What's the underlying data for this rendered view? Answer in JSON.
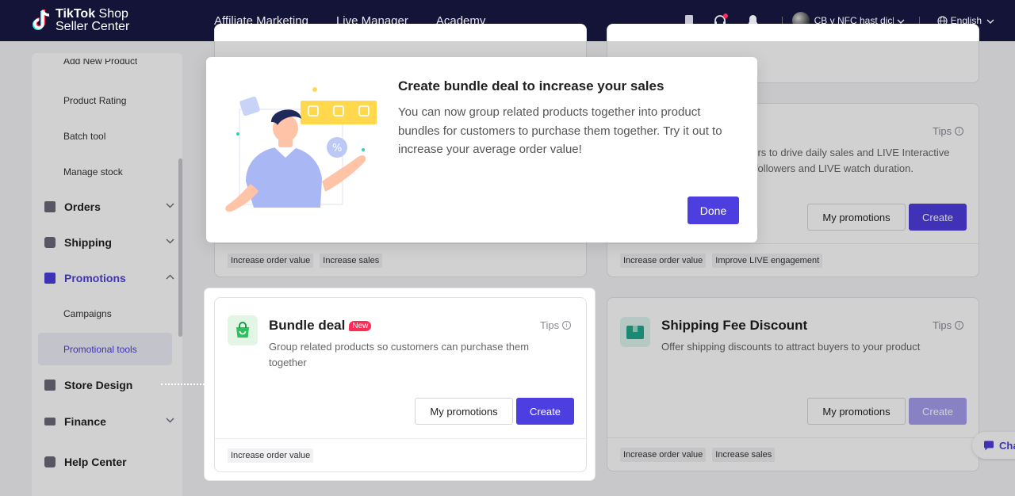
{
  "topbar": {
    "logo_line1_bold": "TikTok",
    "logo_line1_rest": " Shop",
    "logo_line2": "Seller Center",
    "nav": [
      "Affiliate Marketing",
      "Live Manager",
      "Academy"
    ],
    "account_name": "CB v NFC hast dich v",
    "language": "English"
  },
  "sidebar": {
    "sub_items_top": [
      "Add New Product",
      "Product Rating",
      "Batch tool",
      "Manage stock"
    ],
    "orders": "Orders",
    "shipping": "Shipping",
    "promotions": "Promotions",
    "promotions_sub": [
      "Campaigns",
      "Promotional tools"
    ],
    "store_design": "Store Design",
    "finance": "Finance",
    "help_center": "Help Center"
  },
  "cards": {
    "top_right": {
      "desc": "ners to drive daily sales and LIVE Interactive e followers and LIVE watch duration.",
      "desc_line1": "ners to drive daily sales and LIVE Interactive",
      "desc_line2": "e followers and LIVE watch duration.",
      "tips": "Tips",
      "my_promotions": "My promotions",
      "create": "Create",
      "tags": [
        "Increase order value",
        "Improve LIVE engagement"
      ]
    },
    "top_left": {
      "tags": [
        "Increase order value",
        "Increase sales"
      ]
    },
    "bundle": {
      "title": "Bundle deal",
      "badge": "New",
      "tips": "Tips",
      "desc": "Group related products so customers can purchase them together",
      "my_promotions": "My promotions",
      "create": "Create",
      "tags": [
        "Increase order value"
      ]
    },
    "shipping_fee": {
      "title": "Shipping Fee Discount",
      "tips": "Tips",
      "desc": "Offer shipping discounts to attract buyers to your product",
      "my_promotions": "My promotions",
      "create": "Create",
      "tags": [
        "Increase order value",
        "Increase sales"
      ]
    }
  },
  "modal": {
    "title": "Create bundle deal to increase your sales",
    "text": "You can now group related products together into product bundles for customers to purchase them together. Try it out to increase your average order value!",
    "done": "Done"
  },
  "chat": {
    "label": "Cha"
  },
  "colors": {
    "topbar": "#131438",
    "primary": "#4d3ee0",
    "badge": "#fe2c55",
    "promo_active": "#4d3ee0"
  }
}
